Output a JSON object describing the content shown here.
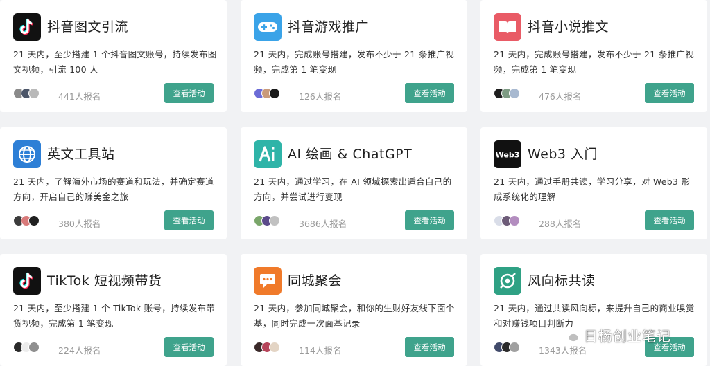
{
  "button_label": "查看活动",
  "colors": {
    "accent": "#3fa38c",
    "background": "#f1f2f4"
  },
  "cards": [
    {
      "icon": "tiktok-icon",
      "title": "抖音图文引流",
      "desc": "21 天内，至少搭建 1 个抖音图文账号，持续发布图文视频，引流 100 人",
      "count": "441人报名"
    },
    {
      "icon": "gamepad-icon",
      "title": "抖音游戏推广",
      "desc": "21 天内，完成账号搭建，发布不少于 21 条推广视频，完成第 1 笔变现",
      "count": "126人报名"
    },
    {
      "icon": "book-icon",
      "title": "抖音小说推文",
      "desc": "21 天内，完成账号搭建，发布不少于 21 条推广视频，完成第 1 笔变现",
      "count": "476人报名"
    },
    {
      "icon": "globe-icon",
      "title": "英文工具站",
      "desc": "21 天内，了解海外市场的赛道和玩法，并确定赛道方向，开启自己的赚美金之旅",
      "count": "380人报名"
    },
    {
      "icon": "ai-icon",
      "title": "AI 绘画 & ChatGPT",
      "desc": "21 天内，通过学习，在 AI 领域探索出适合自己的方向，并尝试进行变现",
      "count": "3686人报名"
    },
    {
      "icon": "web3-icon",
      "title": "Web3 入门",
      "desc": "21 天内，通过手册共读，学习分享，对 Web3 形成系统化的理解",
      "count": "288人报名"
    },
    {
      "icon": "tiktok-icon",
      "title": "TikTok 短视频带货",
      "desc": "21 天内，至少搭建 1 个 TikTok 账号，持续发布带货视频，完成第 1 笔变现",
      "count": "224人报名"
    },
    {
      "icon": "chat-bubble-icon",
      "title": "同城聚会",
      "desc": "21 天内，参加同城聚会，和你的生财好友线下面个基，同时完成一次面基记录",
      "count": "114人报名"
    },
    {
      "icon": "compass-icon",
      "title": "风向标共读",
      "desc": "21 天内，通过共读风向标，来提升自己的商业嗅觉和对赚钱项目判断力",
      "count": "1343人报名"
    }
  ],
  "watermark": {
    "text": "日杨创业笔记",
    "icon": "wechat-icon"
  }
}
